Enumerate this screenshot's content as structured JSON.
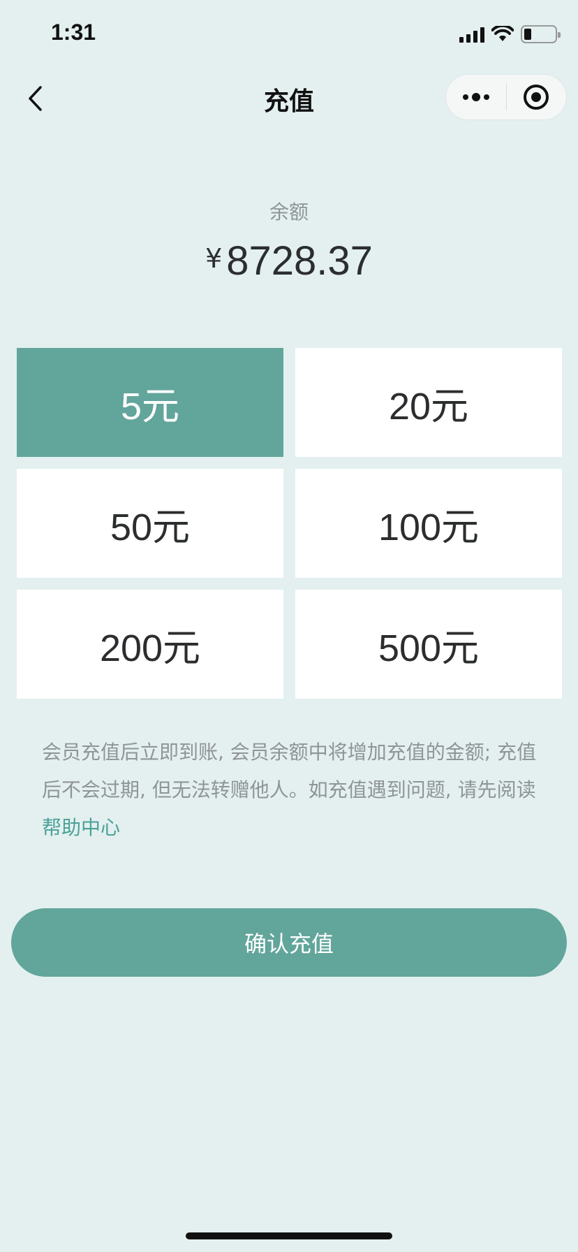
{
  "status_bar": {
    "time": "1:31",
    "icons": [
      "signal-icon",
      "wifi-icon",
      "battery-icon"
    ]
  },
  "nav": {
    "title": "充值",
    "back_icon": "chevron-left-icon",
    "more_icon": "more-dots-icon",
    "close_icon": "target-circle-icon"
  },
  "balance": {
    "label": "余额",
    "currency": "¥",
    "amount": "8728.37"
  },
  "options": [
    {
      "label": "5元",
      "selected": true
    },
    {
      "label": "20元",
      "selected": false
    },
    {
      "label": "50元",
      "selected": false
    },
    {
      "label": "100元",
      "selected": false
    },
    {
      "label": "200元",
      "selected": false
    },
    {
      "label": "500元",
      "selected": false
    }
  ],
  "notice": {
    "text": "会员充值后立即到账, 会员余额中将增加充值的金额; 充值后不会过期, 但无法转赠他人。如充值遇到问题, 请先阅读",
    "link": "帮助中心"
  },
  "confirm_label": "确认充值",
  "colors": {
    "accent": "#62a59b",
    "background": "#e3f0ef",
    "link": "#4aa198"
  }
}
